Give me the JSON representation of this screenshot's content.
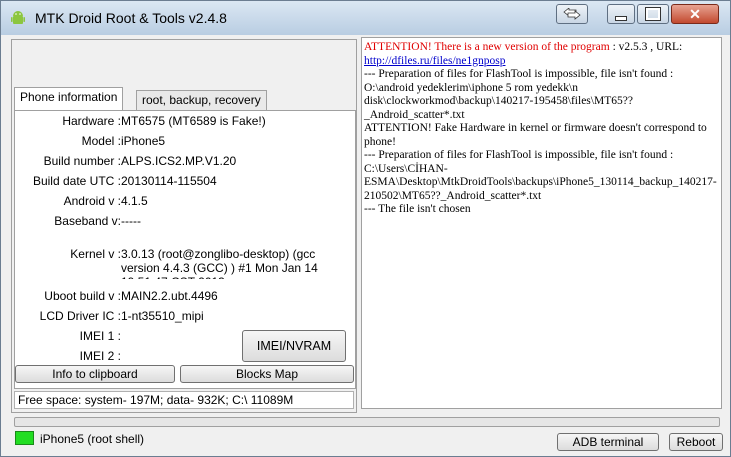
{
  "window": {
    "title": "MTK Droid Root & Tools v2.4.8"
  },
  "tabs": [
    {
      "label": "Phone information"
    },
    {
      "label": "root, backup, recovery"
    }
  ],
  "phone_info": [
    {
      "label": "Hardware :",
      "value": "MT6575 (MT6589 is Fake!)"
    },
    {
      "label": "Model :",
      "value": "iPhone5"
    },
    {
      "label": "Build number :",
      "value": "ALPS.ICS2.MP.V1.20"
    },
    {
      "label": "Build date UTC :",
      "value": "20130114-115504"
    },
    {
      "label": "Android  v :",
      "value": "4.1.5"
    },
    {
      "label": "Baseband v:",
      "value": "-----"
    },
    {
      "label": "Kernel v :",
      "value": "3.0.13 (root@zonglibo-desktop) (gcc version 4.4.3 (GCC) ) #1  Mon Jan 14 19:51:47 CST 2013"
    },
    {
      "label": "Uboot build v :",
      "value": "MAIN2.2.ubt.4496"
    },
    {
      "label": "LCD Driver IC :",
      "value": "1-nt35510_mipi"
    },
    {
      "label": "IMEI 1 :",
      "value": ""
    },
    {
      "label": "IMEI 2 :",
      "value": ""
    }
  ],
  "buttons": {
    "imei_nvram": "IMEI/NVRAM",
    "info_to_clipboard": "Info to clipboard",
    "blocks_map": "Blocks Map",
    "adb_terminal": "ADB terminal",
    "reboot": "Reboot"
  },
  "free_space": "Free space: system- 197M; data- 932K;  C:\\ 11089M",
  "log": {
    "line1_red": "ATTENTION!  There is a new version of the program",
    "line1_rest": " : v2.5.3 , URL:",
    "link": "http://dfiles.ru/files/ne1gnposp",
    "line2": " --- Preparation of files for FlashTool is impossible, file isn't found : O:\\android yedeklerim\\iphone 5 rom yedekk\\n disk\\clockworkmod\\backup\\140217-195458\\files\\MT65??_Android_scatter*.txt",
    "line3": "ATTENTION!  Fake Hardware in kernel or firmware doesn't correspond to phone!",
    "line4": " --- Preparation of files for FlashTool is impossible, file isn't found : C:\\Users\\CİHAN-ESMA\\Desktop\\MtkDroidTools\\backups\\iPhone5_130114_backup_140217-210502\\MT65??_Android_scatter*.txt",
    "line5": " --- The file isn't chosen"
  },
  "status": {
    "text": "iPhone5 (root shell)",
    "color": "#22dd22"
  },
  "icons": [
    "android-icon",
    "swap-icon",
    "minimize-icon",
    "maximize-icon",
    "close-icon"
  ]
}
